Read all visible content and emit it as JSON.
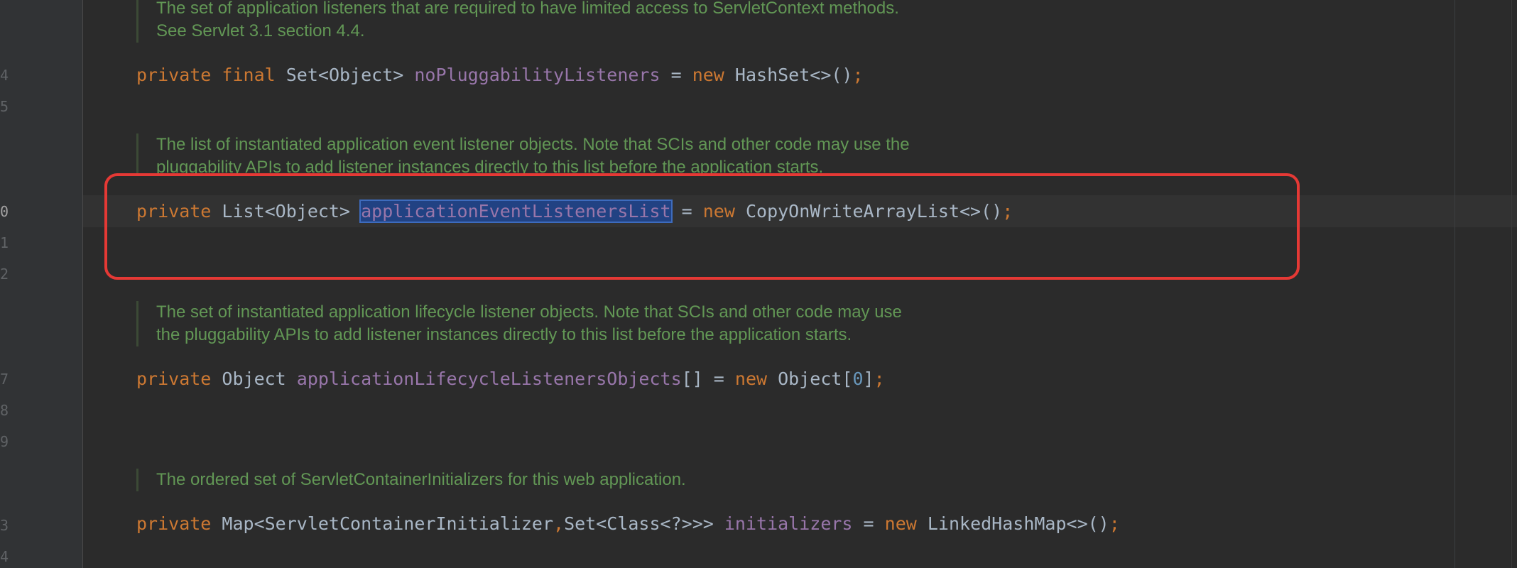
{
  "gutter": {
    "lines": [
      {
        "label": "4",
        "current": false
      },
      {
        "label": "5",
        "current": false
      },
      {
        "label": "0",
        "current": true
      },
      {
        "label": "1",
        "current": false
      },
      {
        "label": "2",
        "current": false
      },
      {
        "label": "7",
        "current": false
      },
      {
        "label": "8",
        "current": false
      },
      {
        "label": "9",
        "current": false
      },
      {
        "label": "3",
        "current": false
      },
      {
        "label": "4",
        "current": false
      }
    ]
  },
  "docs": [
    {
      "lines": [
        "The set of application listeners that are required to have limited access to ServletContext methods.",
        "See Servlet 3.1 section 4.4."
      ]
    },
    {
      "lines": [
        "The list of instantiated application event listener objects. Note that SCIs and other code may use the",
        "pluggability APIs to add listener instances directly to this list before the application starts."
      ]
    },
    {
      "lines": [
        "The set of instantiated application lifecycle listener objects. Note that SCIs and other code may use",
        "the pluggability APIs to add listener instances directly to this list before the application starts."
      ]
    },
    {
      "lines": [
        "The ordered set of ServletContainerInitializers for this web application."
      ]
    }
  ],
  "code": {
    "no_pluggability": {
      "kw_private": "private ",
      "kw_final": "final ",
      "type": "Set<Object> ",
      "field": "noPluggabilityListeners",
      "assign": " = ",
      "kw_new": "new ",
      "ctor": "HashSet<>()",
      "semi": ";"
    },
    "event_listeners": {
      "kw_private": "private ",
      "type": "List<Object> ",
      "field": "applicationEventListenersList",
      "assign": " = ",
      "kw_new": "new ",
      "ctor": "CopyOnWriteArrayList<>()",
      "semi": ";"
    },
    "lifecycle_listeners": {
      "kw_private": "private ",
      "type": "Object ",
      "field": "applicationLifecycleListenersObjects",
      "rest": "[] = ",
      "kw_new": "new ",
      "ctor_open": "Object[",
      "zero": "0",
      "ctor_close": "]",
      "semi": ";"
    },
    "initializers": {
      "kw_private": "private ",
      "type1": "Map<ServletContainerInitializer",
      "comma": ",",
      "type2": "Set<Class<?>>> ",
      "field": "initializers",
      "assign": " = ",
      "kw_new": "new ",
      "ctor": "LinkedHashMap<>()",
      "semi": ";"
    }
  },
  "colors": {
    "background": "#2b2b2b",
    "keyword": "#cc7832",
    "field": "#9876aa",
    "doc": "#629755",
    "number": "#6897bb",
    "selection": "#214283",
    "highlight_box": "#e53935"
  }
}
